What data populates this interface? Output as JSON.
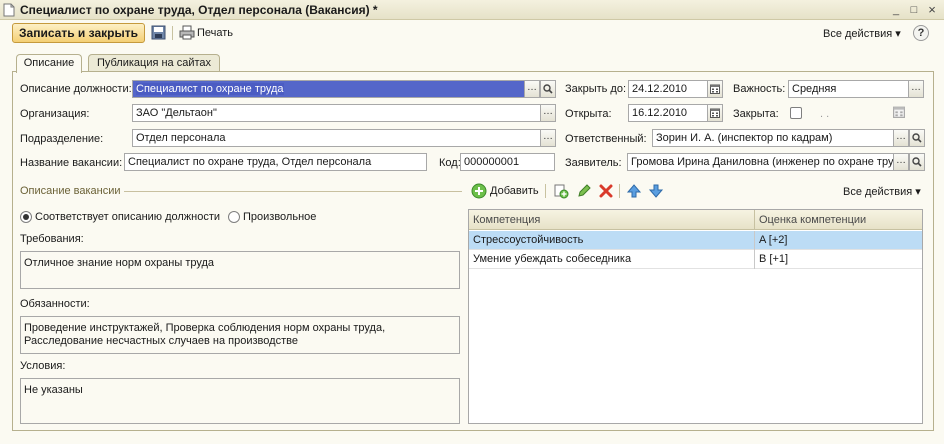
{
  "window": {
    "title": "Специалист по охране труда, Отдел персонала (Вакансия) *",
    "minimize": "_",
    "maximize": "□",
    "close": "×"
  },
  "toolbar": {
    "save_close_label": "Записать и закрыть",
    "print_label": "Печать",
    "all_actions_label": "Все действия",
    "help_label": "?"
  },
  "tabs": [
    {
      "label": "Описание",
      "active": true
    },
    {
      "label": "Публикация на сайтах",
      "active": false
    }
  ],
  "form": {
    "position_label": "Описание должности:",
    "position_value": "Специалист по охране труда",
    "organization_label": "Организация:",
    "organization_value": "ЗАО \"Дельтаон\"",
    "department_label": "Подразделение:",
    "department_value": "Отдел персонала",
    "vacancy_name_label": "Название вакансии:",
    "vacancy_name_value": "Специалист по охране труда, Отдел персонала",
    "code_label": "Код:",
    "code_value": "000000001",
    "close_until_label": "Закрыть до:",
    "close_until_value": "24.12.2010",
    "opened_label": "Открыта:",
    "opened_value": "16.12.2010",
    "importance_label": "Важность:",
    "importance_value": "Средняя",
    "closed_label": "Закрыта:",
    "closed_date_value": ". .",
    "responsible_label": "Ответственный:",
    "responsible_value": "Зорин И. А. (инспектор по кадрам)",
    "applicant_label": "Заявитель:",
    "applicant_value": "Громова Ирина Даниловна (инженер по охране тру"
  },
  "description": {
    "section_title": "Описание вакансии",
    "radio_matches": "Соответствует описанию должности",
    "radio_arbitrary": "Произвольное",
    "requirements_label": "Требования:",
    "requirements_value": "Отличное знание норм охраны труда",
    "duties_label": "Обязанности:",
    "duties_value": "Проведение инструктажей, Проверка соблюдения норм охраны труда,\nРасследование несчастных случаев на производстве",
    "conditions_label": "Условия:",
    "conditions_value": "Не указаны"
  },
  "competencies": {
    "add_label": "Добавить",
    "all_actions_label": "Все действия",
    "columns": [
      "Компетенция",
      "Оценка компетенции"
    ],
    "rows": [
      {
        "competency": "Стрессоустойчивость",
        "rating": "A [+2]",
        "selected": true
      },
      {
        "competency": "Умение убеждать собеседника",
        "rating": "B [+1]",
        "selected": false
      }
    ]
  },
  "colors": {
    "accent_button": "#f4cf75",
    "selected_field": "#5466c9",
    "selected_row": "#bcdcf5",
    "background": "#fbfaf2"
  }
}
